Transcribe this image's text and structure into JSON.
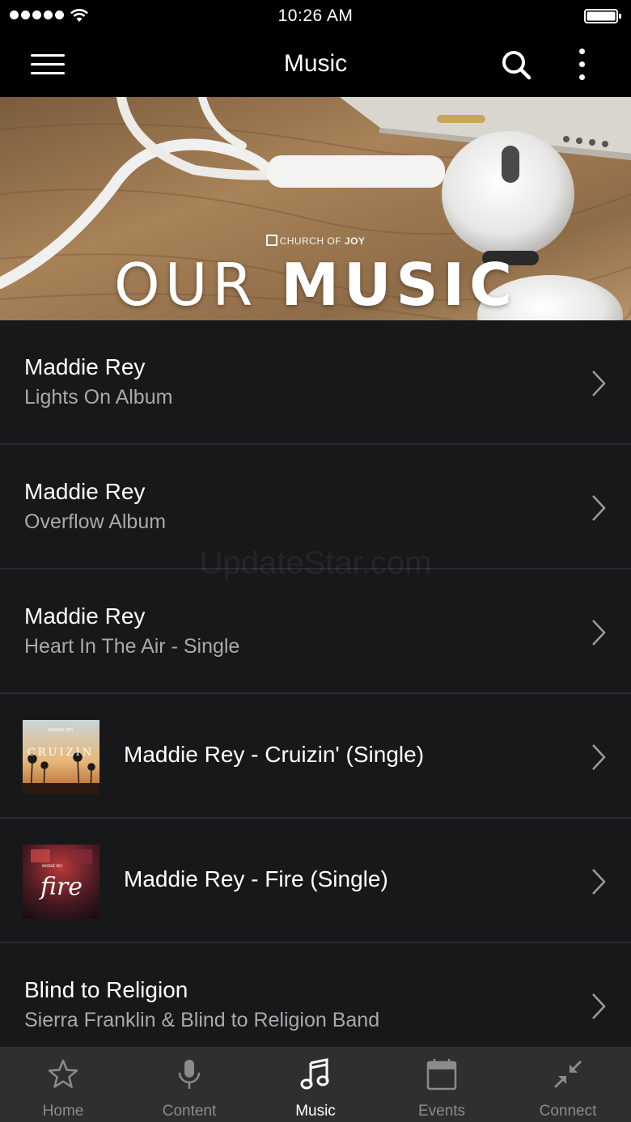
{
  "status_bar": {
    "time": "10:26 AM"
  },
  "header": {
    "title": "Music"
  },
  "hero": {
    "brand_prefix": "CHURCH OF ",
    "brand_bold": "JOY",
    "title_light": "OUR ",
    "title_bold": "MUSIC"
  },
  "watermark": "UpdateStar.com",
  "list": [
    {
      "title": "Maddie Rey",
      "subtitle": "Lights On Album"
    },
    {
      "title": "Maddie Rey",
      "subtitle": "Overflow Album"
    },
    {
      "title": "Maddie Rey",
      "subtitle": "Heart In The Air - Single"
    },
    {
      "title": "Maddie Rey - Cruizin' (Single)",
      "thumb_text": "CRUIZIN",
      "thumb_small": "MADDIE REY"
    },
    {
      "title": "Maddie Rey - Fire (Single)",
      "thumb_text": "fire",
      "thumb_small": "MADDIE REY"
    },
    {
      "title": "Blind to Religion",
      "subtitle": "Sierra Franklin & Blind to Religion Band"
    }
  ],
  "tabs": [
    {
      "label": "Home",
      "icon": "star-icon"
    },
    {
      "label": "Content",
      "icon": "microphone-icon"
    },
    {
      "label": "Music",
      "icon": "music-note-icon",
      "active": true
    },
    {
      "label": "Events",
      "icon": "calendar-icon"
    },
    {
      "label": "Connect",
      "icon": "compress-arrows-icon"
    }
  ]
}
